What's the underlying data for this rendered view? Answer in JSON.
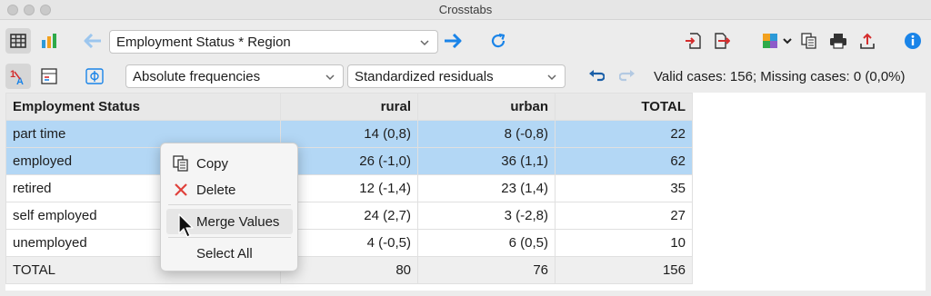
{
  "window": {
    "title": "Crosstabs"
  },
  "toolbar": {
    "table_selector": "Employment Status * Region",
    "display_mode": "Absolute frequencies",
    "residual_mode": "Standardized residuals",
    "status": "Valid cases: 156;  Missing cases: 0 (0,0%)"
  },
  "table": {
    "headers": [
      "Employment Status",
      "rural",
      "urban",
      "TOTAL"
    ],
    "rows": [
      {
        "label": "part time",
        "rural": "14 (0,8)",
        "urban": "8 (-0,8)",
        "total": "22"
      },
      {
        "label": "employed",
        "rural": "26 (-1,0)",
        "urban": "36 (1,1)",
        "total": "62"
      },
      {
        "label": "retired",
        "rural": "12 (-1,4)",
        "urban": "23 (1,4)",
        "total": "35"
      },
      {
        "label": "self employed",
        "rural": "24 (2,7)",
        "urban": "3 (-2,8)",
        "total": "27"
      },
      {
        "label": "unemployed",
        "rural": "4 (-0,5)",
        "urban": "6 (0,5)",
        "total": "10"
      },
      {
        "label": "TOTAL",
        "rural": "80",
        "urban": "76",
        "total": "156"
      }
    ]
  },
  "context_menu": {
    "copy": "Copy",
    "delete": "Delete",
    "merge_values": "Merge Values",
    "select_all": "Select All"
  },
  "colors": {
    "accent_blue": "#1a84e8",
    "selection": "#b3d7f5",
    "delete_red": "#e0413b"
  }
}
